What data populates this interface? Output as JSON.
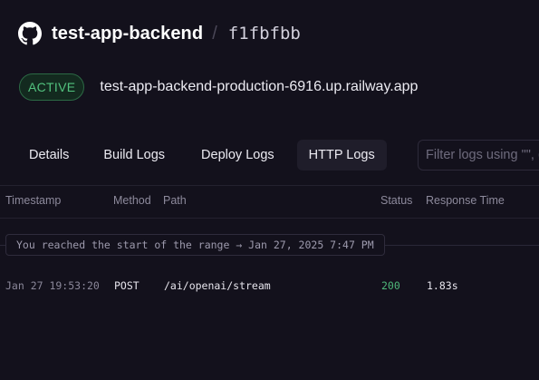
{
  "header": {
    "icon": "github-icon",
    "repo_name": "test-app-backend",
    "separator": "/",
    "commit": "f1fbfbb"
  },
  "deployment": {
    "status": "ACTIVE",
    "domain": "test-app-backend-production-6916.up.railway.app"
  },
  "tabs": [
    {
      "label": "Details"
    },
    {
      "label": "Build Logs"
    },
    {
      "label": "Deploy Logs"
    },
    {
      "label": "HTTP Logs",
      "active": true
    }
  ],
  "filter": {
    "placeholder": "Filter logs using \"\", (",
    "value": ""
  },
  "table": {
    "columns": [
      "Timestamp",
      "Method",
      "Path",
      "Status",
      "Response Time"
    ],
    "range_notice": "You reached the start of the range → Jan 27, 2025 7:47 PM",
    "rows": [
      {
        "timestamp": "Jan 27 19:53:20",
        "method": "POST",
        "path": "/ai/openai/stream",
        "status": "200",
        "response_time": "1.83s"
      }
    ]
  },
  "colors": {
    "background": "#13111c",
    "active_green": "#52c27e",
    "status_ok": "#4fb87a"
  }
}
